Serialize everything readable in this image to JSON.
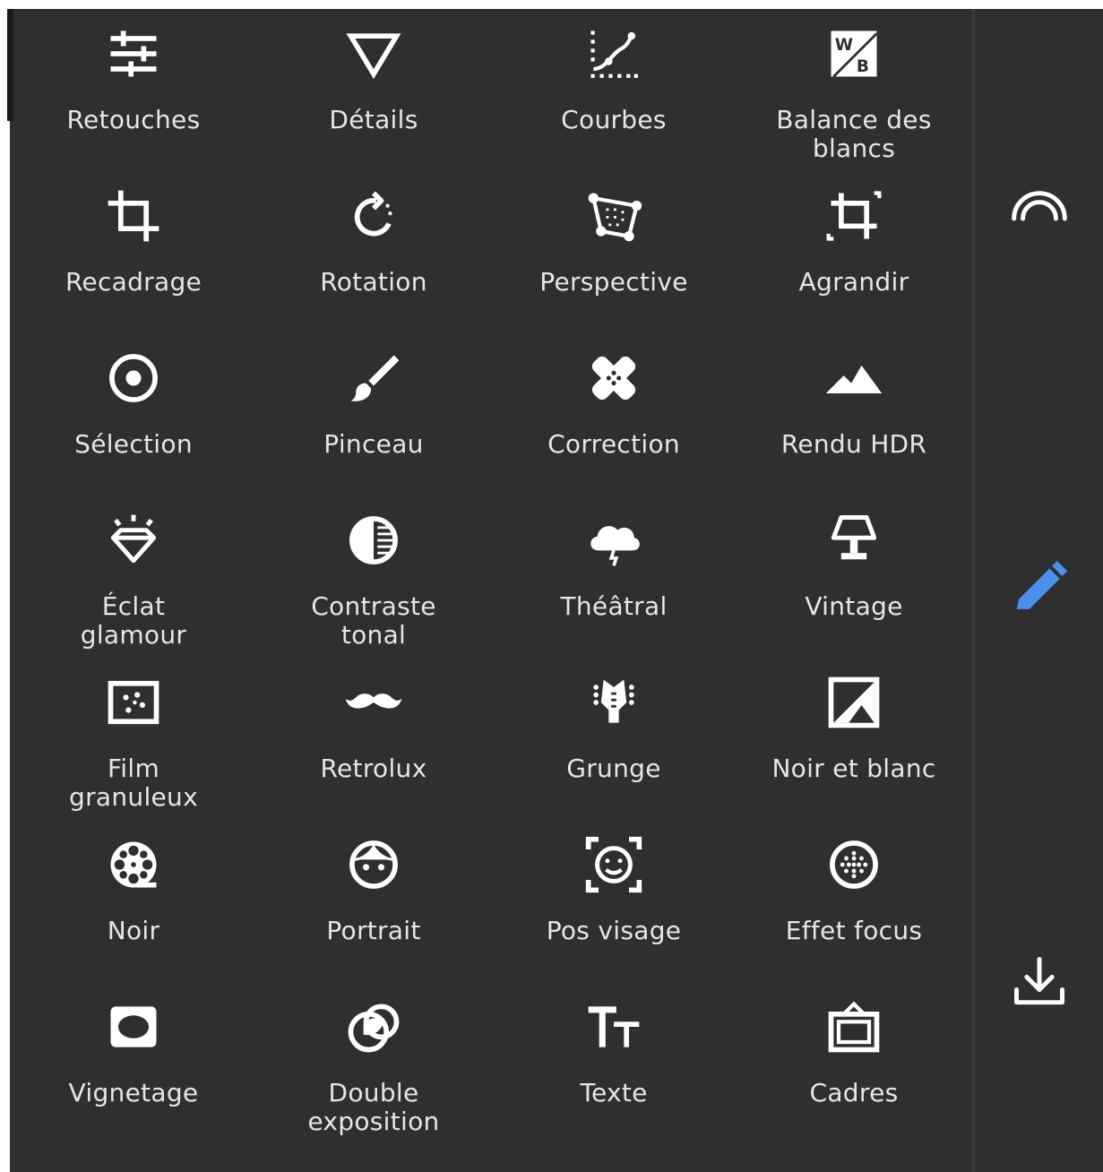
{
  "tools": [
    {
      "label": "Retouches",
      "icon": "tune-sliders-icon"
    },
    {
      "label": "Détails",
      "icon": "triangle-details-icon"
    },
    {
      "label": "Courbes",
      "icon": "curves-icon"
    },
    {
      "label": "Balance des\nblancs",
      "icon": "white-balance-icon"
    },
    {
      "label": "Recadrage",
      "icon": "crop-icon"
    },
    {
      "label": "Rotation",
      "icon": "rotate-icon"
    },
    {
      "label": "Perspective",
      "icon": "perspective-icon"
    },
    {
      "label": "Agrandir",
      "icon": "expand-icon"
    },
    {
      "label": "Sélection",
      "icon": "selective-icon"
    },
    {
      "label": "Pinceau",
      "icon": "brush-icon"
    },
    {
      "label": "Correction",
      "icon": "healing-icon"
    },
    {
      "label": "Rendu HDR",
      "icon": "hdr-mountain-icon"
    },
    {
      "label": "Éclat\nglamour",
      "icon": "glamour-diamond-icon"
    },
    {
      "label": "Contraste\ntonal",
      "icon": "tonal-contrast-icon"
    },
    {
      "label": "Théâtral",
      "icon": "drama-cloud-icon"
    },
    {
      "label": "Vintage",
      "icon": "vintage-lamp-icon"
    },
    {
      "label": "Film\ngranuleux",
      "icon": "grainy-film-icon"
    },
    {
      "label": "Retrolux",
      "icon": "mustache-icon"
    },
    {
      "label": "Grunge",
      "icon": "grunge-guitar-icon"
    },
    {
      "label": "Noir et blanc",
      "icon": "black-white-icon"
    },
    {
      "label": "Noir",
      "icon": "film-reel-icon"
    },
    {
      "label": "Portrait",
      "icon": "portrait-face-icon"
    },
    {
      "label": "Pos visage",
      "icon": "face-pose-icon"
    },
    {
      "label": "Effet focus",
      "icon": "lens-blur-icon"
    },
    {
      "label": "Vignetage",
      "icon": "vignette-icon"
    },
    {
      "label": "Double\nexposition",
      "icon": "double-exposure-icon"
    },
    {
      "label": "Texte",
      "icon": "text-icon"
    },
    {
      "label": "Cadres",
      "icon": "frames-icon"
    }
  ],
  "rail": [
    {
      "icon": "looks-arc-icon"
    },
    {
      "icon": "edit-pencil-icon",
      "color": "#4a90f0"
    },
    {
      "icon": "export-download-icon"
    }
  ],
  "colors": {
    "background": "#2f2f2f",
    "icon": "#ffffff",
    "label": "#e6e6e6",
    "accent": "#4a90f0"
  }
}
